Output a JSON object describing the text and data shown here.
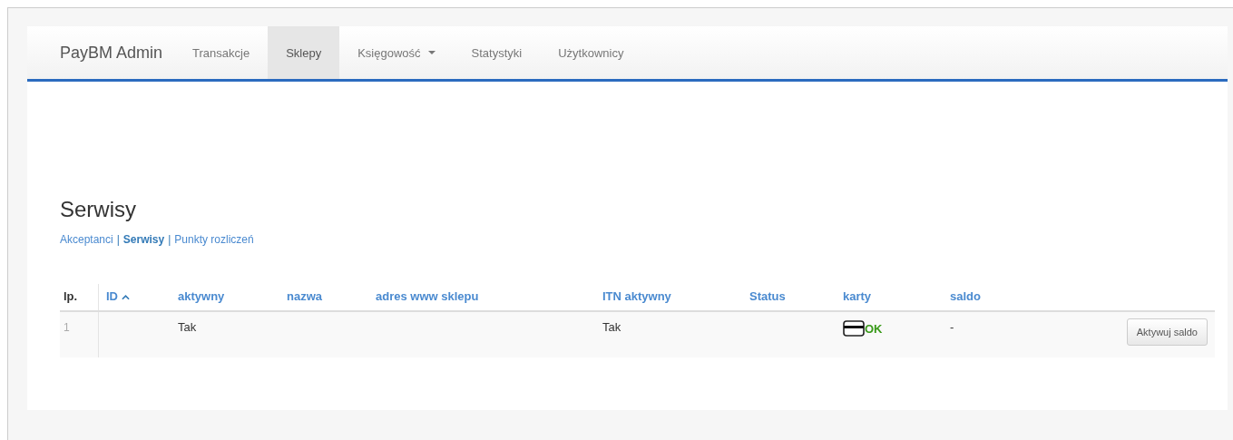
{
  "navbar": {
    "brand": "PayBM Admin",
    "items": [
      {
        "label": "Transakcje",
        "selected": false,
        "dropdown": false
      },
      {
        "label": "Sklepy",
        "selected": true,
        "dropdown": false
      },
      {
        "label": "Księgowość",
        "selected": false,
        "dropdown": true
      },
      {
        "label": "Statystyki",
        "selected": false,
        "dropdown": false
      },
      {
        "label": "Użytkownicy",
        "selected": false,
        "dropdown": false
      }
    ]
  },
  "page": {
    "title": "Serwisy",
    "subnav_separators": [
      "|",
      "|"
    ],
    "subnav": [
      {
        "label": "Akceptanci",
        "selected": false
      },
      {
        "label": "Serwisy",
        "selected": true
      },
      {
        "label": "Punkty rozliczeń",
        "selected": false
      }
    ]
  },
  "table": {
    "columns": [
      {
        "label": "lp.",
        "sortable": false
      },
      {
        "label": "ID",
        "sortable": true,
        "sorted_ascending": true
      },
      {
        "label": "aktywny",
        "sortable": true
      },
      {
        "label": "nazwa",
        "sortable": true
      },
      {
        "label": "adres www sklepu",
        "sortable": true
      },
      {
        "label": "ITN aktywny",
        "sortable": true
      },
      {
        "label": "Status",
        "sortable": true
      },
      {
        "label": "karty",
        "sortable": true
      },
      {
        "label": "saldo",
        "sortable": true
      }
    ],
    "rows": [
      {
        "cells": [
          "1",
          "",
          "Tak",
          "",
          "",
          "Tak",
          "",
          "OK",
          "-"
        ],
        "button": "Aktywuj saldo"
      }
    ]
  }
}
